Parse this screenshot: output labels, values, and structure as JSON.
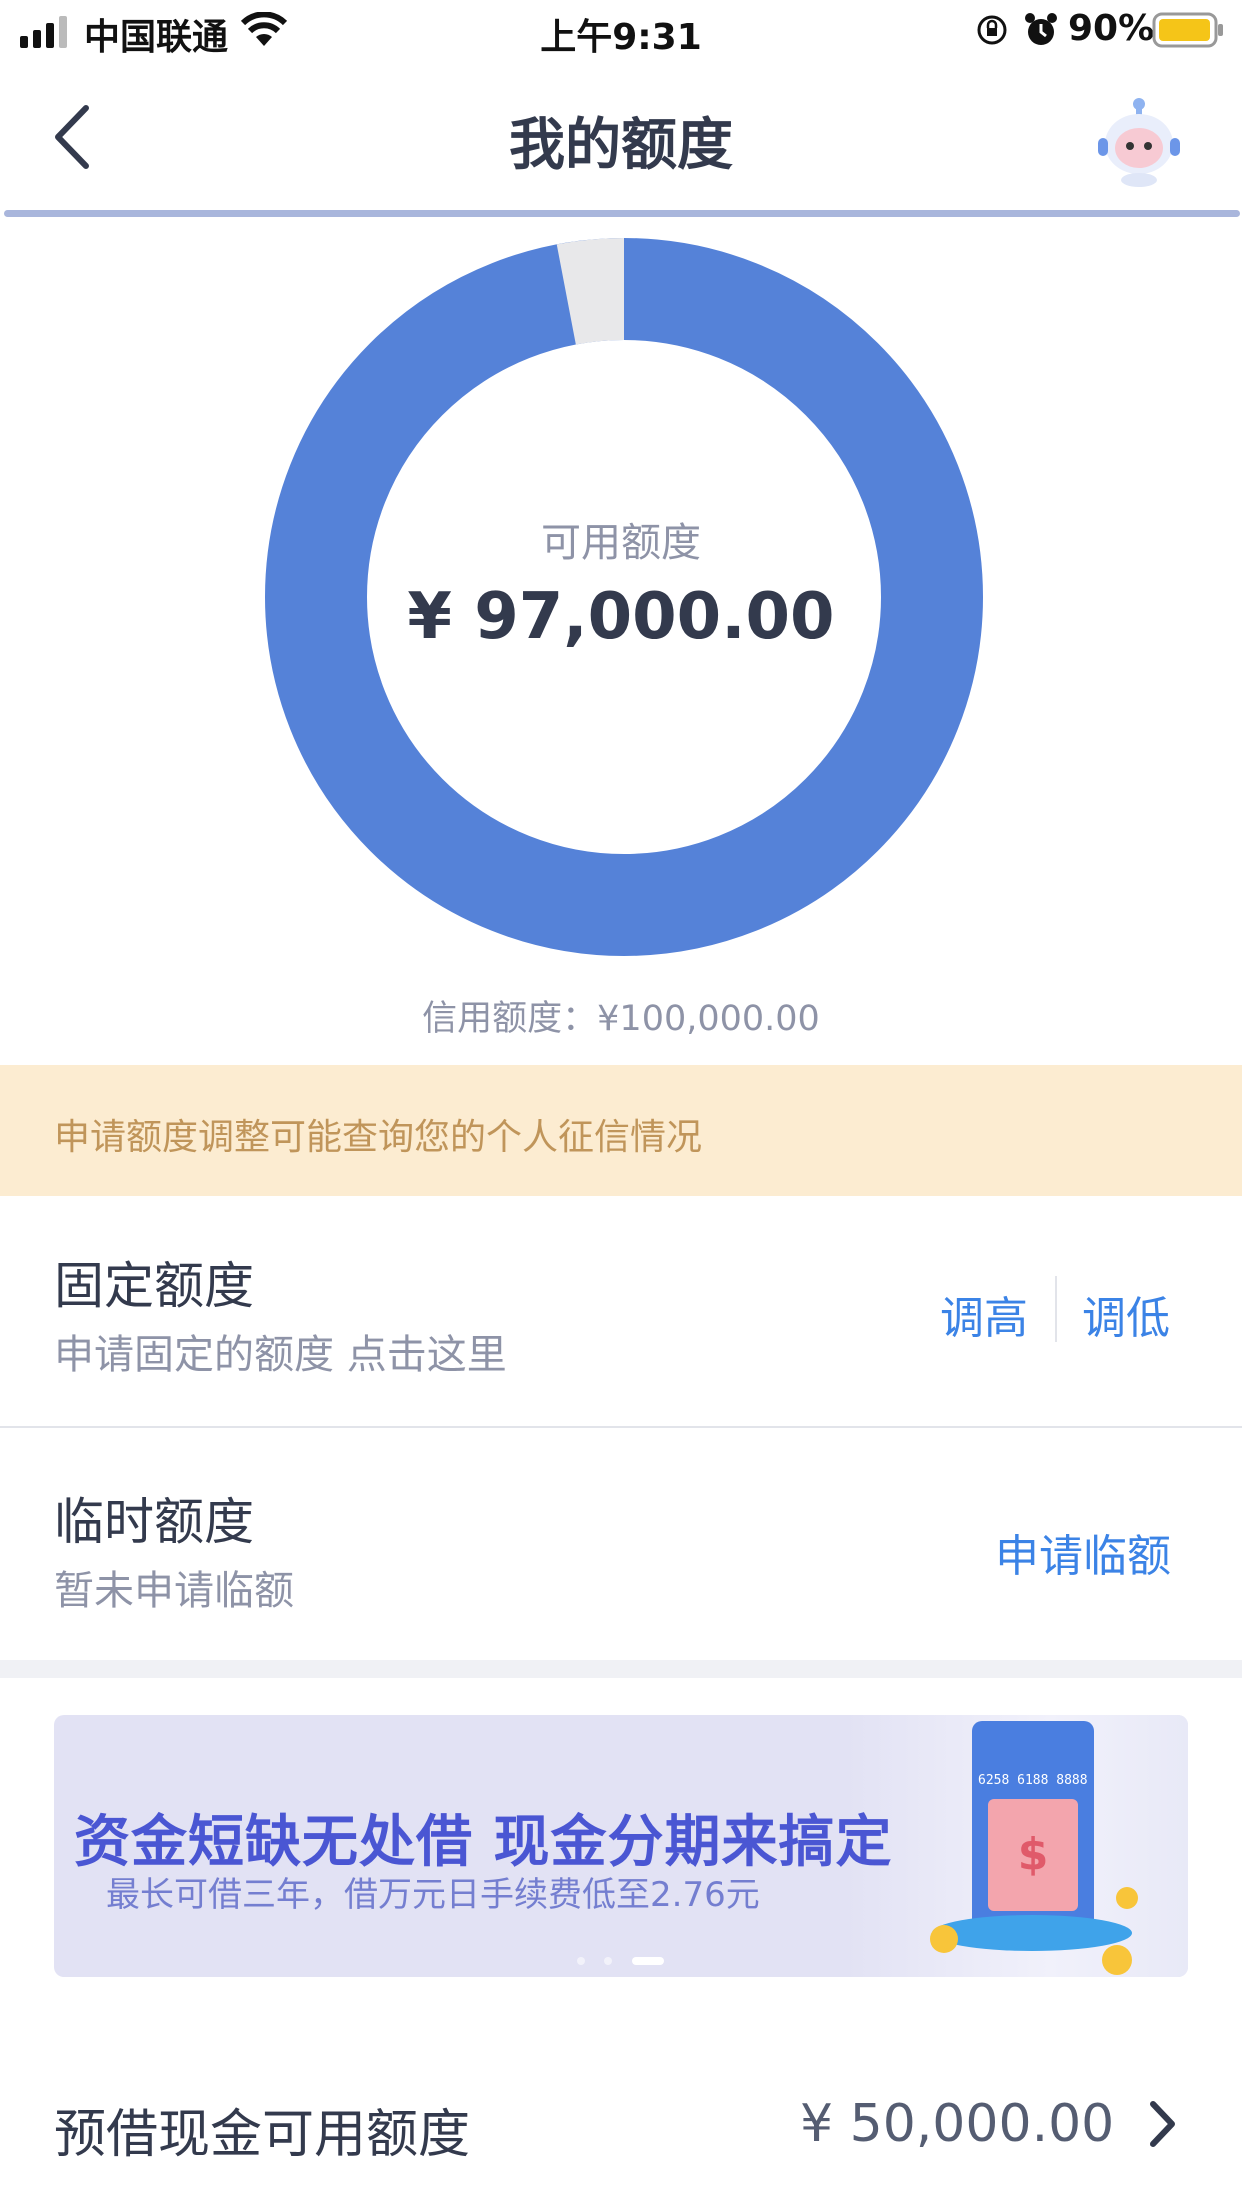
{
  "status_bar": {
    "carrier": "中国联通",
    "time": "上午9:31",
    "battery": "90%"
  },
  "nav": {
    "title": "我的额度"
  },
  "quota": {
    "available_label": "可用额度",
    "available_value": "¥ 97,000.00",
    "credit_line": "信用额度：¥100,000.00",
    "used_fraction": 0.03
  },
  "notice": {
    "text": "申请额度调整可能查询您的个人征信情况"
  },
  "fixed_quota": {
    "title": "固定额度",
    "subtitle": "申请固定的额度 点击这里",
    "raise_label": "调高",
    "lower_label": "调低"
  },
  "temp_quota": {
    "title": "临时额度",
    "subtitle": "暂未申请临额",
    "apply_label": "申请临额"
  },
  "banner": {
    "title": "资金短缺无处借 现金分期来搞定",
    "subtitle": "最长可借三年，借万元日手续费低至2.76元",
    "card_number": "6258 6188 8888"
  },
  "pre_borrow": {
    "label": "预借现金可用额度",
    "value": "¥ 50,000.00"
  },
  "colors": {
    "accent": "#3b83e6",
    "donut_fill": "#5582d8",
    "donut_rest": "#e8e8ea",
    "notice_bg": "#fcecd1"
  }
}
